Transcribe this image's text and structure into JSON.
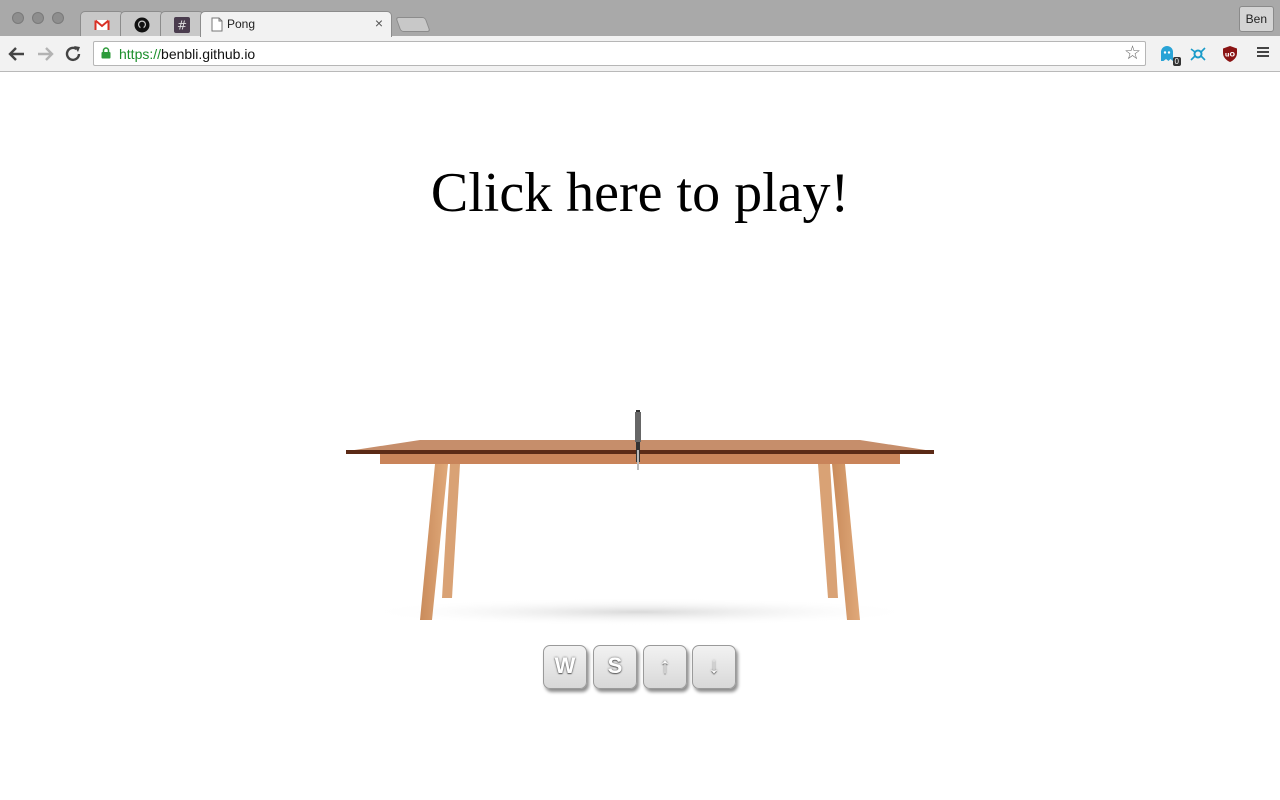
{
  "browser": {
    "tabs": [
      {
        "icon": "gmail-icon"
      },
      {
        "icon": "github-icon"
      },
      {
        "icon": "slack-hash-icon"
      },
      {
        "title": "Pong",
        "icon": "page-icon",
        "active": true
      }
    ],
    "close_glyph": "×",
    "profile_label": "Ben",
    "url_scheme": "https://",
    "url_host": "benbli.github.io",
    "extension_badge": "0"
  },
  "page": {
    "headline": "Click here to play!",
    "keys": [
      "W",
      "S",
      "↑",
      "↓"
    ]
  }
}
